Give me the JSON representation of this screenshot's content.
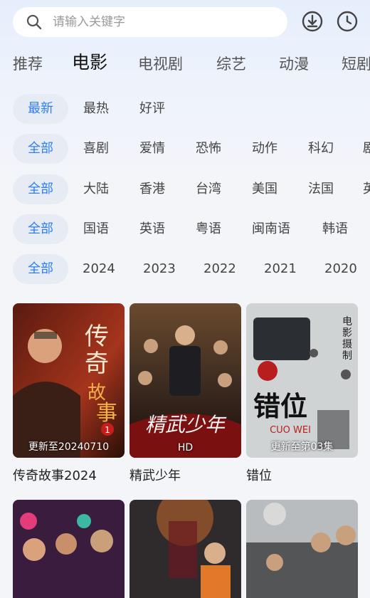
{
  "search": {
    "placeholder": "请输入关键字"
  },
  "icons": {
    "search": "search-icon",
    "download": "download-icon",
    "history": "history-clock-icon"
  },
  "tabs": [
    "推荐",
    "电影",
    "电视剧",
    "综艺",
    "动漫",
    "短剧"
  ],
  "active_tab": "电影",
  "accent_color": "#2f7ef2",
  "filters": {
    "sort": [
      "最新",
      "最热",
      "好评"
    ],
    "genre": [
      "全部",
      "喜剧",
      "爱情",
      "恐怖",
      "动作",
      "科幻",
      "剧"
    ],
    "region": [
      "全部",
      "大陆",
      "香港",
      "台湾",
      "美国",
      "法国",
      "英"
    ],
    "language": [
      "全部",
      "国语",
      "英语",
      "粤语",
      "闽南语",
      "韩语"
    ],
    "year": [
      "全部",
      "2024",
      "2023",
      "2022",
      "2021",
      "2020"
    ]
  },
  "movies": [
    {
      "title": "传奇故事2024",
      "badge": "更新至20240710",
      "poster_text": "传奇故事"
    },
    {
      "title": "精武少年",
      "badge": "HD",
      "poster_text": "精武少年"
    },
    {
      "title": "错位",
      "badge": "更新至第03集",
      "poster_text": "错位"
    }
  ]
}
